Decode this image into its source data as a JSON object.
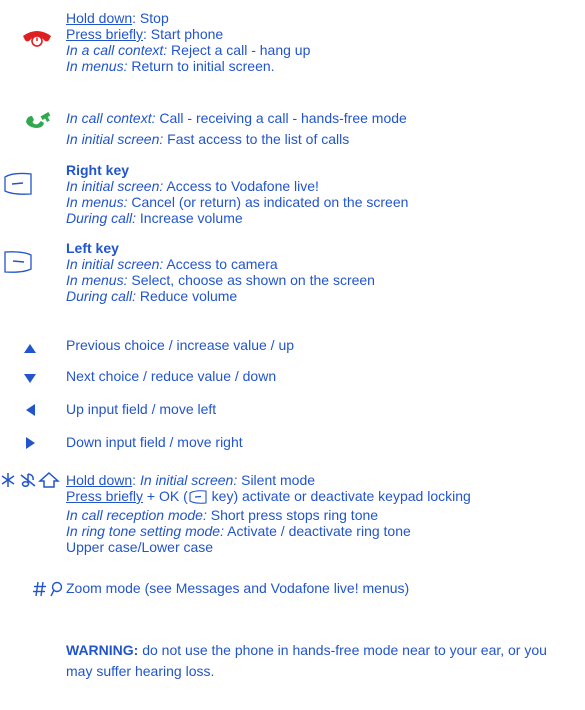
{
  "entries": [
    {
      "icon": "red-hangup-handset-icon",
      "lines": [
        {
          "u": "Hold down",
          "rest": ": Stop"
        },
        {
          "u": "Press briefly",
          "rest": ": Start phone"
        },
        {
          "i": "In a call context:",
          "rest": " Reject a call - hang up"
        },
        {
          "i": "In menus:",
          "rest": " Return to initial screen."
        }
      ]
    },
    {
      "icon": "green-call-handset-icon",
      "lines": [
        {
          "i": "In call context:",
          "rest": " Call - receiving a call - hands-free mode"
        },
        {
          "i": "In initial screen:",
          "rest": " Fast access to the list of calls"
        }
      ]
    },
    {
      "icon": "right-softkey-icon",
      "title": "Right key",
      "lines": [
        {
          "i": "In initial screen:",
          "rest": " Access to Vodafone live!"
        },
        {
          "i": "In menus:",
          "rest": " Cancel (or return) as indicated on the screen"
        },
        {
          "i": "During call:",
          "rest": " Increase volume"
        }
      ]
    },
    {
      "icon": "left-softkey-icon",
      "title": "Left key",
      "lines": [
        {
          "i": "In initial screen:",
          "rest": " Access to camera"
        },
        {
          "i": "In menus:",
          "rest": " Select, choose as shown on the screen"
        },
        {
          "i": "During call:",
          "rest": "  Reduce volume"
        }
      ]
    },
    {
      "icon": "up-arrow-icon",
      "lines": [
        {
          "rest": "Previous choice / increase value / up"
        }
      ]
    },
    {
      "icon": "down-arrow-icon",
      "lines": [
        {
          "rest": "Next choice / reduce value / down"
        }
      ]
    },
    {
      "icon": "left-arrow-icon",
      "lines": [
        {
          "rest": "Up input field / move left"
        }
      ]
    },
    {
      "icon": "right-arrow-icon",
      "lines": [
        {
          "rest": "Down input field / move right"
        }
      ]
    },
    {
      "icon": "star-key-icon",
      "lines": [
        {
          "u": "Hold down",
          "rest": ": ",
          "i2": "In initial screen:",
          "rest2": " Silent mode"
        },
        {
          "u": "Press briefly",
          "rest": " + OK (",
          "rest2": " key) activate or deactivate keypad locking"
        },
        {
          "i": "In call reception mode:",
          "rest": " Short press stops ring tone"
        },
        {
          "i": "In ring tone setting mode:",
          "rest": " Activate / deactivate ring tone"
        },
        {
          "rest": "Upper case/Lower case"
        }
      ]
    },
    {
      "icon": "hash-key-icon",
      "lines": [
        {
          "rest": "Zoom mode (see Messages and Vodafone live! menus)"
        }
      ]
    }
  ],
  "warning": {
    "label": "WARNING:",
    "text": " do not use the phone in hands-free mode near to your ear, or you may suffer hearing loss."
  }
}
